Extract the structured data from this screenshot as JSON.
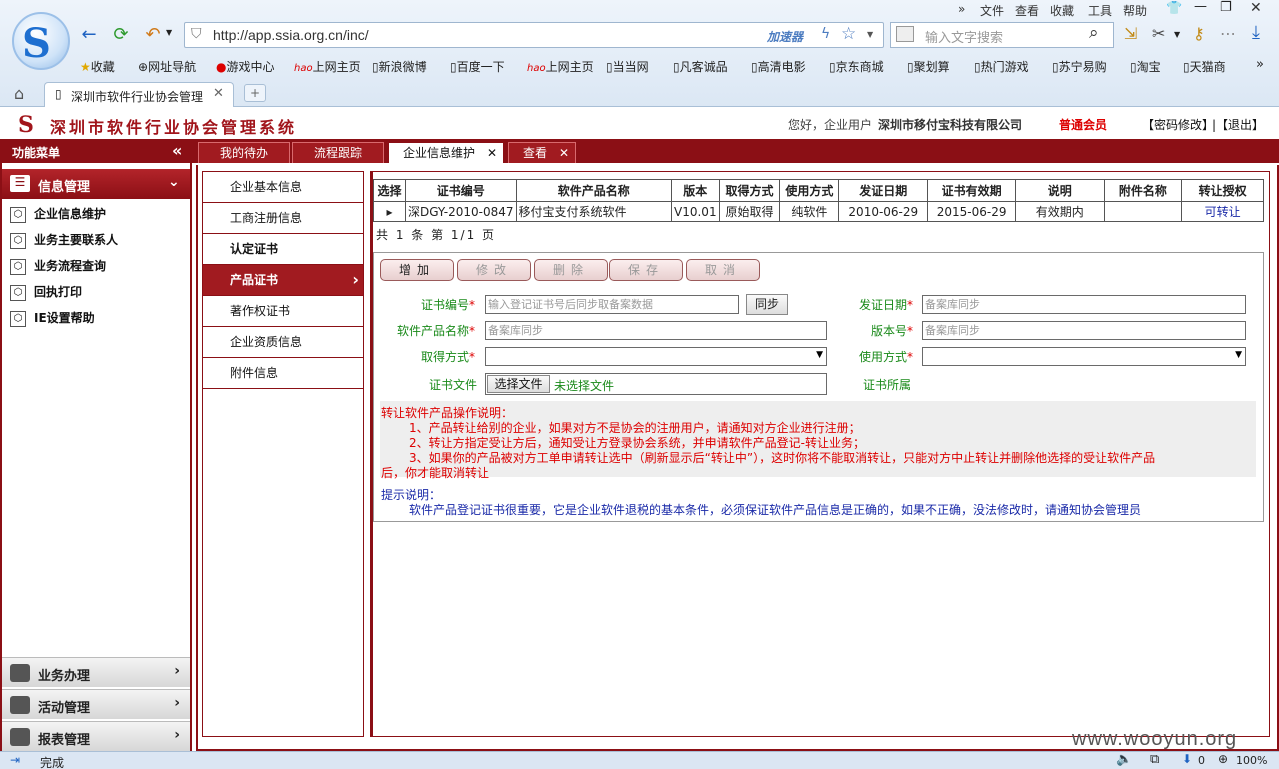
{
  "browser": {
    "menu": [
      "文件",
      "查看",
      "收藏",
      "工具",
      "帮助"
    ],
    "url": "http://app.ssia.org.cn/inc/",
    "accelerator": "加速器",
    "search_placeholder": "输入文字搜索",
    "bookmarks": [
      "收藏",
      "网址导航",
      "游戏中心",
      "上网主页",
      "新浪微博",
      "百度一下",
      "上网主页",
      "当当网",
      "凡客诚品",
      "高清电影",
      "京东商城",
      "聚划算",
      "热门游戏",
      "苏宁易购",
      "淘宝",
      "天猫商"
    ],
    "tab_title": "深圳市软件行业协会管理",
    "status_text": "完成",
    "zoom": "100%",
    "status_count": "0"
  },
  "header": {
    "system_title": "深圳市软件行业协会管理系统",
    "greeting": "您好，企业用户",
    "company": "深圳市移付宝科技有限公司",
    "member_level": "普通会员",
    "change_password": "【密码修改】",
    "logout": "|【退出】"
  },
  "sidebar": {
    "title": "功能菜单",
    "collapse_icon": "«",
    "group_open": "信息管理",
    "items": [
      "企业信息维护",
      "业务主要联系人",
      "业务流程查询",
      "回执打印",
      "IE设置帮助"
    ],
    "groups": [
      "业务办理",
      "活动管理",
      "报表管理"
    ]
  },
  "tabs": [
    {
      "label": "我的待办",
      "closable": false
    },
    {
      "label": "流程跟踪",
      "closable": false
    },
    {
      "label": "企业信息维护",
      "closable": true,
      "active": true
    },
    {
      "label": "查看",
      "closable": true
    }
  ],
  "subnav": [
    "企业基本信息",
    "工商注册信息",
    "认定证书",
    "产品证书",
    "著作权证书",
    "企业资质信息",
    "附件信息"
  ],
  "grid": {
    "headers": [
      "选择",
      "证书编号",
      "软件产品名称",
      "版本",
      "取得方式",
      "使用方式",
      "发证日期",
      "证书有效期",
      "说明",
      "附件名称",
      "转让授权"
    ],
    "rows": [
      [
        "▸",
        "深DGY-2010-0847",
        "移付宝支付系统软件",
        "V10.01",
        "原始取得",
        "纯软件",
        "2010-06-29",
        "2015-06-29",
        "有效期内",
        "",
        "可转让"
      ]
    ],
    "pager": "共 1 条 第 1/1 页"
  },
  "buttons": [
    "增加",
    "修改",
    "删除",
    "保存",
    "取消"
  ],
  "form": {
    "cert_no_label": "证书编号",
    "cert_no_placeholder": "输入登记证书号后同步取备案数据",
    "sync_button": "同步",
    "issue_date_label": "发证日期",
    "issue_date_placeholder": "备案库同步",
    "product_name_label": "软件产品名称",
    "product_name_placeholder": "备案库同步",
    "version_label": "版本号",
    "version_placeholder": "备案库同步",
    "acquire_label": "取得方式",
    "use_label": "使用方式",
    "file_label": "证书文件",
    "file_button": "选择文件",
    "file_status": "未选择文件",
    "owner_label": "证书所属"
  },
  "notes": {
    "title": "转让软件产品操作说明：",
    "line1": "1、产品转让给别的企业，如果对方不是协会的注册用户，请通知对方企业进行注册；",
    "line2": "2、转让方指定受让方后，通知受让方登录协会系统，并申请软件产品登记-转让业务；",
    "line3a": "3、如果你的产品被对方工单申请转让选中（刷新显示后“转让中”），这时你将不能取消转让，只能对方中止转让并删除他选择的受让软件产品",
    "line3b": "后，你才能取消转让",
    "tip_title": "提示说明：",
    "tip_text": "软件产品登记证书很重要，它是企业软件退税的基本条件，必须保证软件产品信息是正确的，如果不正确，没法修改时，请通知协会管理员"
  },
  "watermark": "www.wooyun.org",
  "colors": {
    "accent": "#8b0f15",
    "label_green": "#1a8a1a",
    "required": "#dd0000",
    "tip_blue": "#1a2aa8",
    "link_blue": "#1a2aa8"
  }
}
